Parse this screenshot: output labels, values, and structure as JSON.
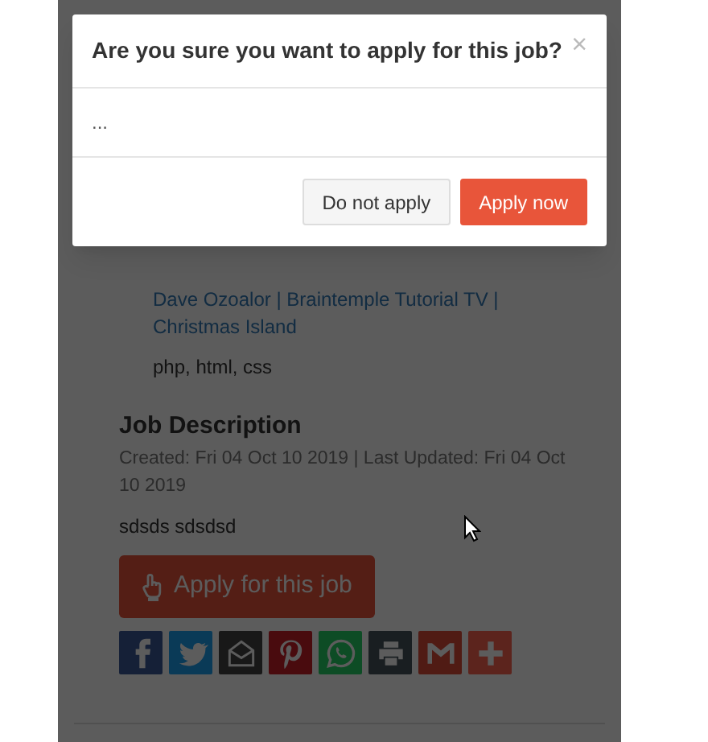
{
  "modal": {
    "title": "Are you sure you want to apply for this job?",
    "close": "×",
    "body": "...",
    "buttons": [
      {
        "label": "Do not apply",
        "kind": "secondary"
      },
      {
        "label": "Apply now",
        "kind": "primary"
      }
    ]
  },
  "job": {
    "author_line": "Dave Ozoalor | Braintemple Tutorial TV | Christmas Island",
    "skills": "php, html, css",
    "description_heading": "Job Description",
    "dates": "Created: Fri 04 Oct 10 2019 | Last Updated: Fri 04 Oct 10 2019",
    "description": "sdsds sdsdsd",
    "apply_button": "Apply for this job",
    "share_buttons": [
      {
        "kind": "facebook"
      },
      {
        "kind": "twitter"
      },
      {
        "kind": "email"
      },
      {
        "kind": "pinterest"
      },
      {
        "kind": "whatsapp"
      },
      {
        "kind": "print"
      },
      {
        "kind": "gmail"
      },
      {
        "kind": "more"
      }
    ]
  }
}
